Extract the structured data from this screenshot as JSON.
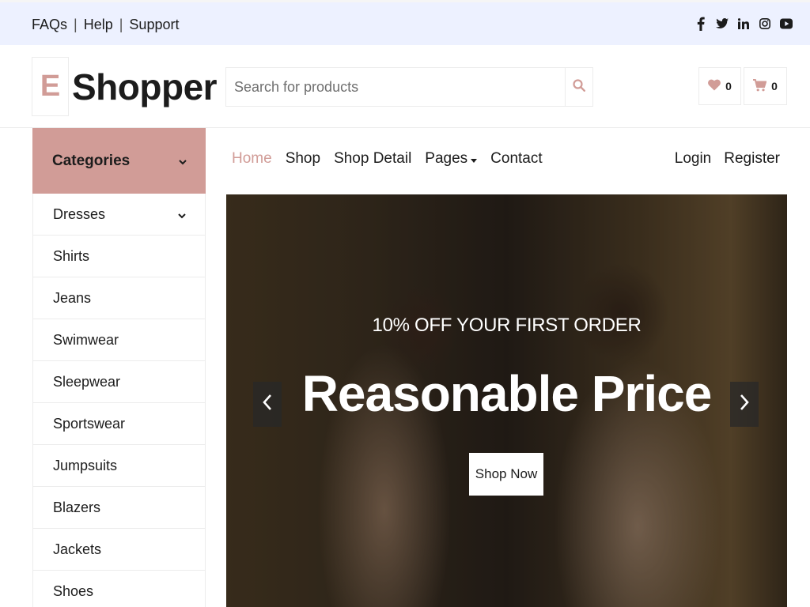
{
  "topbar": {
    "links": [
      "FAQs",
      "Help",
      "Support"
    ],
    "social_icons": [
      "facebook-icon",
      "twitter-icon",
      "linkedin-icon",
      "instagram-icon",
      "youtube-icon"
    ]
  },
  "header": {
    "logo_letter": "E",
    "logo_text": "Shopper",
    "search_placeholder": "Search for products",
    "wishlist_count": "0",
    "cart_count": "0"
  },
  "sidebar": {
    "title": "Categories",
    "items": [
      "Dresses",
      "Shirts",
      "Jeans",
      "Swimwear",
      "Sleepwear",
      "Sportswear",
      "Jumpsuits",
      "Blazers",
      "Jackets",
      "Shoes"
    ]
  },
  "nav": {
    "items": [
      "Home",
      "Shop",
      "Shop Detail",
      "Pages",
      "Contact"
    ],
    "right": [
      "Login",
      "Register"
    ]
  },
  "hero": {
    "subtitle": "10% OFF YOUR FIRST ORDER",
    "title": "Reasonable Price",
    "button": "Shop Now"
  },
  "colors": {
    "accent": "#d19c97",
    "topbar_bg": "#edf1ff",
    "text": "#1c1c1c"
  }
}
